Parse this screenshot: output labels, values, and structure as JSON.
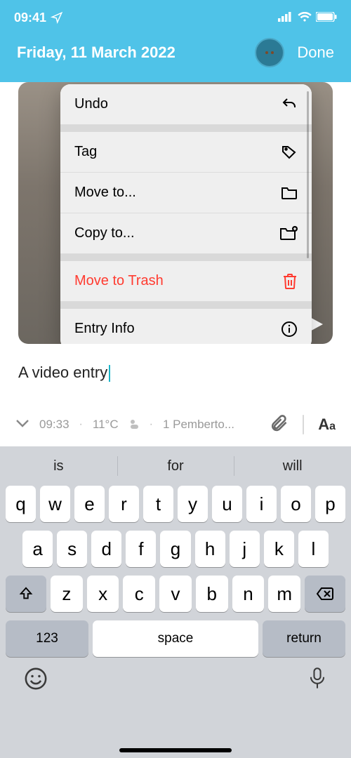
{
  "status": {
    "time": "09:41"
  },
  "header": {
    "title": "Friday, 11 March 2022",
    "done": "Done"
  },
  "menu": {
    "undo": "Undo",
    "tag": "Tag",
    "move": "Move to...",
    "copy": "Copy to...",
    "trash": "Move to Trash",
    "info": "Entry Info"
  },
  "entry": {
    "text": "A video entry"
  },
  "meta": {
    "time": "09:33",
    "weather": "11°C",
    "location": "1 Pemberto..."
  },
  "suggestions": {
    "a": "is",
    "b": "for",
    "c": "will"
  },
  "keys": {
    "row1": [
      "q",
      "w",
      "e",
      "r",
      "t",
      "y",
      "u",
      "i",
      "o",
      "p"
    ],
    "row2": [
      "a",
      "s",
      "d",
      "f",
      "g",
      "h",
      "j",
      "k",
      "l"
    ],
    "row3": [
      "z",
      "x",
      "c",
      "v",
      "b",
      "n",
      "m"
    ],
    "num": "123",
    "space": "space",
    "ret": "return"
  }
}
